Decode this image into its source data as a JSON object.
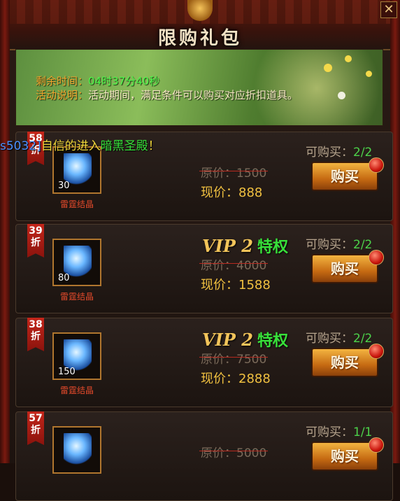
{
  "header": {
    "title": "限购礼包",
    "close_label": "✕"
  },
  "banner": {
    "time_label": "剩余时间：",
    "time_value": "04时37分40秒",
    "desc_label": "活动说明：",
    "desc_value": "活动期间，满足条件可以购买对应折扣道具。"
  },
  "ticker": {
    "part1": "s5032]",
    "part2": "自信的进入",
    "part3": "暗黑圣殿",
    "part4": "！"
  },
  "cards": [
    {
      "discount": "58",
      "discount_unit": "折",
      "item_qty": "30",
      "item_name": "雷霆结晶",
      "vip_text": "",
      "vip_level": "",
      "vip_priv": "",
      "orig_label": "原价：",
      "orig_price": "1500",
      "now_label": "现价：",
      "now_price": "888",
      "limit_label": "可购买：",
      "limit_value": "2/2",
      "buy_label": "购买"
    },
    {
      "discount": "39",
      "discount_unit": "折",
      "item_qty": "80",
      "item_name": "雷霆结晶",
      "vip_text": "VIP",
      "vip_level": "2",
      "vip_priv": "特权",
      "orig_label": "原价：",
      "orig_price": "4000",
      "now_label": "现价：",
      "now_price": "1588",
      "limit_label": "可购买：",
      "limit_value": "2/2",
      "buy_label": "购买"
    },
    {
      "discount": "38",
      "discount_unit": "折",
      "item_qty": "150",
      "item_name": "雷霆结晶",
      "vip_text": "VIP",
      "vip_level": "2",
      "vip_priv": "特权",
      "orig_label": "原价：",
      "orig_price": "7500",
      "now_label": "现价：",
      "now_price": "2888",
      "limit_label": "可购买：",
      "limit_value": "2/2",
      "buy_label": "购买"
    },
    {
      "discount": "57",
      "discount_unit": "折",
      "item_qty": "",
      "item_name": "",
      "vip_text": "",
      "vip_level": "",
      "vip_priv": "",
      "orig_label": "原价：",
      "orig_price": "5000",
      "now_label": "现价：",
      "now_price": "",
      "limit_label": "可购买：",
      "limit_value": "1/1",
      "buy_label": "购买"
    }
  ]
}
